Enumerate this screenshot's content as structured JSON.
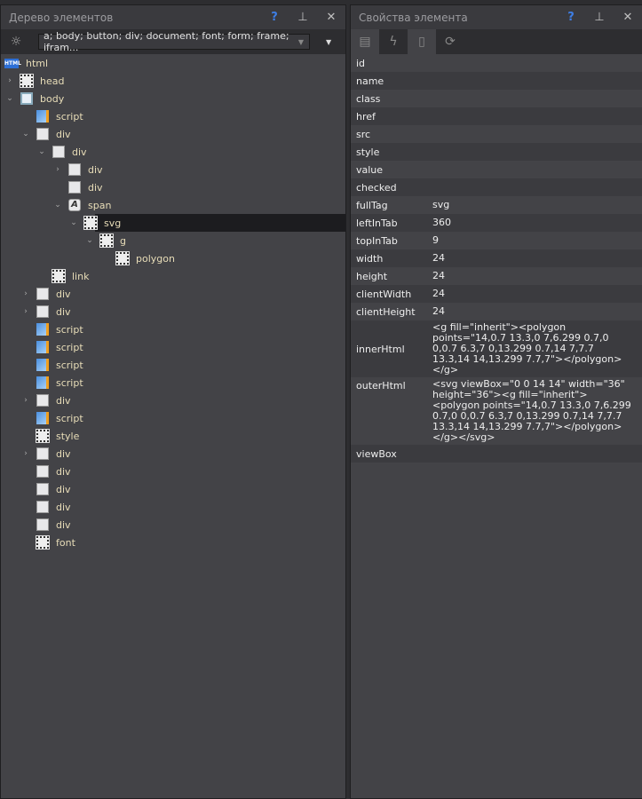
{
  "left": {
    "title": "Дерево элементов",
    "help": "?",
    "pin": "⊥",
    "close": "✕",
    "filter_value": "a; body; button; div; document; font; form; frame; ifram...",
    "tree": [
      {
        "label": "html",
        "level": 0,
        "icon": "html",
        "arrow": ""
      },
      {
        "label": "head",
        "level": 1,
        "icon": "chip-box",
        "arrow": "collapsed"
      },
      {
        "label": "body",
        "level": 1,
        "icon": "body",
        "arrow": "expanded"
      },
      {
        "label": "script",
        "level": 2,
        "icon": "script",
        "arrow": ""
      },
      {
        "label": "div",
        "level": 2,
        "icon": "box",
        "arrow": "expanded"
      },
      {
        "label": "div",
        "level": 3,
        "icon": "box",
        "arrow": "expanded"
      },
      {
        "label": "div",
        "level": 4,
        "icon": "box",
        "arrow": "collapsed"
      },
      {
        "label": "div",
        "level": 4,
        "icon": "box",
        "arrow": ""
      },
      {
        "label": "span",
        "level": 4,
        "icon": "a",
        "arrow": "expanded"
      },
      {
        "label": "svg",
        "level": 5,
        "icon": "chip",
        "arrow": "expanded",
        "selected": true
      },
      {
        "label": "g",
        "level": 6,
        "icon": "chip",
        "arrow": "expanded"
      },
      {
        "label": "polygon",
        "level": 7,
        "icon": "chip",
        "arrow": ""
      },
      {
        "label": "link",
        "level": 3,
        "icon": "chip",
        "arrow": ""
      },
      {
        "label": "div",
        "level": 2,
        "icon": "box",
        "arrow": "collapsed"
      },
      {
        "label": "div",
        "level": 2,
        "icon": "box",
        "arrow": "collapsed"
      },
      {
        "label": "script",
        "level": 2,
        "icon": "script",
        "arrow": ""
      },
      {
        "label": "script",
        "level": 2,
        "icon": "script",
        "arrow": ""
      },
      {
        "label": "script",
        "level": 2,
        "icon": "script",
        "arrow": ""
      },
      {
        "label": "script",
        "level": 2,
        "icon": "script",
        "arrow": ""
      },
      {
        "label": "div",
        "level": 2,
        "icon": "box",
        "arrow": "collapsed"
      },
      {
        "label": "script",
        "level": 2,
        "icon": "script",
        "arrow": ""
      },
      {
        "label": "style",
        "level": 2,
        "icon": "chip",
        "arrow": ""
      },
      {
        "label": "div",
        "level": 2,
        "icon": "box",
        "arrow": "collapsed"
      },
      {
        "label": "div",
        "level": 2,
        "icon": "box",
        "arrow": ""
      },
      {
        "label": "div",
        "level": 2,
        "icon": "box",
        "arrow": ""
      },
      {
        "label": "div",
        "level": 2,
        "icon": "box",
        "arrow": ""
      },
      {
        "label": "div",
        "level": 2,
        "icon": "box",
        "arrow": ""
      },
      {
        "label": "font",
        "level": 2,
        "icon": "chip",
        "arrow": ""
      }
    ]
  },
  "right": {
    "title": "Свойства элемента",
    "help": "?",
    "pin": "⊥",
    "close": "✕",
    "props": [
      {
        "k": "id",
        "v": ""
      },
      {
        "k": "name",
        "v": ""
      },
      {
        "k": "class",
        "v": ""
      },
      {
        "k": "href",
        "v": ""
      },
      {
        "k": "src",
        "v": ""
      },
      {
        "k": "style",
        "v": ""
      },
      {
        "k": "value",
        "v": ""
      },
      {
        "k": "checked",
        "v": ""
      },
      {
        "k": "fullTag",
        "v": "svg"
      },
      {
        "k": "leftInTab",
        "v": "360"
      },
      {
        "k": "topInTab",
        "v": "9"
      },
      {
        "k": "width",
        "v": "24"
      },
      {
        "k": "height",
        "v": "24"
      },
      {
        "k": "clientWidth",
        "v": "24"
      },
      {
        "k": "clientHeight",
        "v": "24"
      },
      {
        "k": "innerHtml",
        "v": "<g fill=\"inherit\"><polygon points=\"14,0.7 13.3,0 7,6.299 0.7,0 0,0.7 6.3,7 0,13.299 0.7,14 7,7.7 13.3,14 14,13.299 7.7,7\"></polygon></g>"
      },
      {
        "k": "outerHtml",
        "v": "<svg viewBox=\"0 0 14 14\" width=\"36\" height=\"36\"><g fill=\"inherit\"><polygon points=\"14,0.7 13.3,0 7,6.299 0.7,0 0,0.7 6.3,7 0,13.299 0.7,14 7,7.7 13.3,14 14,13.299 7.7,7\"></polygon></g></svg>"
      },
      {
        "k": "viewBox",
        "v": ""
      }
    ]
  }
}
